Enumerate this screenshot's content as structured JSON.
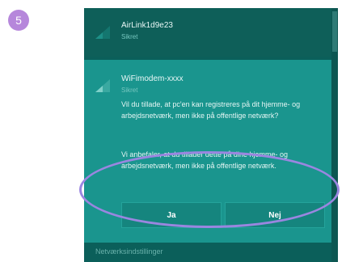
{
  "step": {
    "number": "5"
  },
  "networks": [
    {
      "name": "AirLink1d9e23",
      "status": "Sikret"
    },
    {
      "name": "WiFimodem-xxxx",
      "status": "Sikret"
    }
  ],
  "prompt": {
    "question": "Vil du tillade, at pc'en kan registreres på dit hjemme- og arbejdsnetværk, men ikke på offentlige netværk?",
    "recommendation": "Vi anbefaler, at du tillader dette på dine hjemme- og arbejdsnetværk, men ikke på offentlige netværk.",
    "yes_label": "Ja",
    "no_label": "Nej"
  },
  "footer": {
    "settings_label": "Netværksindstillinger"
  },
  "colors": {
    "badge": "#b687db",
    "highlight": "#9a86e0",
    "selected_row": "#1a958e",
    "panel": "#0b5f5a"
  },
  "icons": {
    "network": "wifi-signal-icon",
    "step": "step-badge"
  }
}
